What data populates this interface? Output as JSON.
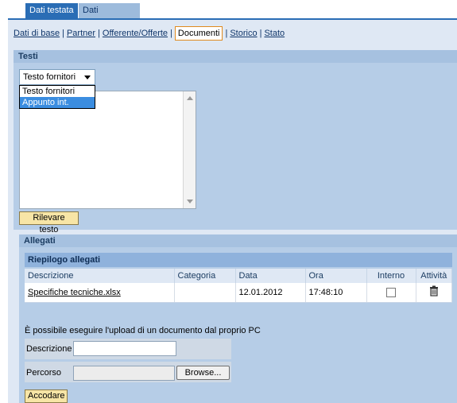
{
  "tabs": [
    {
      "label": "Dati testata",
      "active": true
    },
    {
      "label": "Dati posizione",
      "active": false
    }
  ],
  "subnav": {
    "items": [
      "Dati di base",
      "Partner",
      "Offerente/Offerte",
      "Documenti",
      "Storico",
      "Stato"
    ],
    "current": "Documenti",
    "separator": "|"
  },
  "testi": {
    "title": "Testi",
    "dropdown_value": "Testo fornitori",
    "options": [
      "Testo fornitori",
      "Appunto int."
    ],
    "highlighted_option": "Appunto int.",
    "text_value": "",
    "button_label": "Rilevare testo"
  },
  "allegati": {
    "title": "Allegati",
    "table_title": "Riepilogo allegati",
    "columns": [
      "Descrizione",
      "Categoria",
      "Data",
      "Ora",
      "Interno",
      "Attività"
    ],
    "rows": [
      {
        "descrizione": "Specifiche tecniche.xlsx",
        "categoria": "",
        "data": "12.01.2012",
        "ora": "17:48:10",
        "interno": false,
        "azione_icon": "trash-icon"
      }
    ],
    "upload_text": "È possibile eseguire l'upload di un documento dal proprio PC",
    "descrizione_label": "Descrizione",
    "percorso_label": "Percorso",
    "browse_label": "Browse...",
    "submit_label": "Accodare"
  },
  "colors": {
    "tab_active": "#2a6db5",
    "section_bg": "#b6cde7",
    "button_bg": "#f7e5a6",
    "link": "#10366a"
  }
}
